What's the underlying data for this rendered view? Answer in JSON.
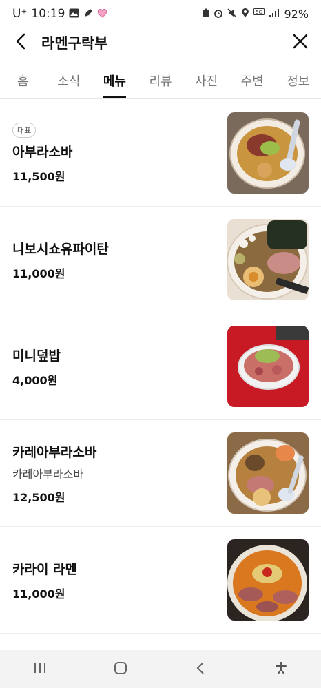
{
  "status_bar": {
    "carrier": "U⁺",
    "time": "10:19",
    "battery": "92%",
    "left_icons": [
      "image-icon",
      "pen-icon",
      "heart-icon"
    ],
    "right_icons": [
      "battery-saver-icon",
      "alarm-icon",
      "mute-icon",
      "location-icon",
      "5g-icon",
      "signal-icon"
    ]
  },
  "header": {
    "title": "라멘구락부",
    "back_icon": "chevron-left-icon",
    "close_icon": "close-icon"
  },
  "tabs": [
    {
      "label": "홈",
      "active": false
    },
    {
      "label": "소식",
      "active": false
    },
    {
      "label": "메뉴",
      "active": true
    },
    {
      "label": "리뷰",
      "active": false
    },
    {
      "label": "사진",
      "active": false
    },
    {
      "label": "주변",
      "active": false
    },
    {
      "label": "정보",
      "active": false
    }
  ],
  "menu": [
    {
      "badge": "대표",
      "name": "아부라소바",
      "desc": "",
      "price": "11,500원"
    },
    {
      "badge": "",
      "name": "니보시쇼유파이탄",
      "desc": "",
      "price": "11,000원"
    },
    {
      "badge": "",
      "name": "미니덮밥",
      "desc": "",
      "price": "4,000원"
    },
    {
      "badge": "",
      "name": "카레아부라소바",
      "desc": "카레아부라소바",
      "price": "12,500원"
    },
    {
      "badge": "",
      "name": "카라이 라멘",
      "desc": "",
      "price": "11,000원"
    }
  ],
  "nav": {
    "icons": [
      "recent-apps-icon",
      "home-icon",
      "back-icon",
      "accessibility-icon"
    ]
  },
  "colors": {
    "accent_text": "#111111",
    "muted_text": "#777777",
    "divider": "#eeeeee",
    "nav_bg": "#f3f3f3"
  }
}
